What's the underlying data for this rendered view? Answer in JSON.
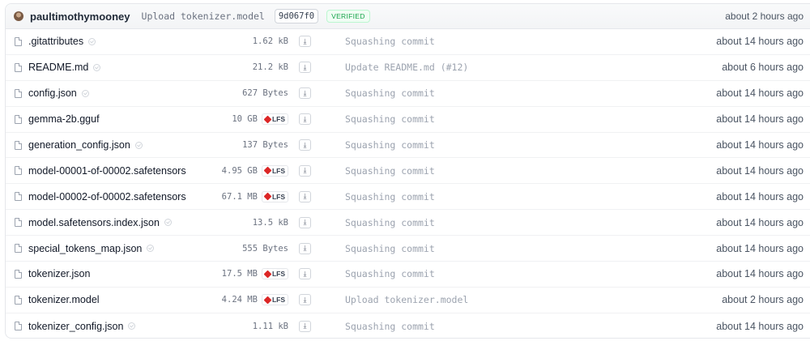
{
  "commit": {
    "author": "paultimothymooney",
    "message": "Upload tokenizer.model",
    "hash": "9d067f0",
    "verified_label": "VERIFIED",
    "time": "about 2 hours ago"
  },
  "lfs_label": "LFS",
  "files": [
    {
      "name": ".gitattributes",
      "size": "1.62 kB",
      "lfs": false,
      "commit": "Squashing commit",
      "time": "about 14 hours ago"
    },
    {
      "name": "README.md",
      "size": "21.2 kB",
      "lfs": false,
      "commit": "Update README.md (#12)",
      "time": "about 6 hours ago"
    },
    {
      "name": "config.json",
      "size": "627 Bytes",
      "lfs": false,
      "commit": "Squashing commit",
      "time": "about 14 hours ago"
    },
    {
      "name": "gemma-2b.gguf",
      "size": "10 GB",
      "lfs": true,
      "commit": "Squashing commit",
      "time": "about 14 hours ago"
    },
    {
      "name": "generation_config.json",
      "size": "137 Bytes",
      "lfs": false,
      "commit": "Squashing commit",
      "time": "about 14 hours ago"
    },
    {
      "name": "model-00001-of-00002.safetensors",
      "size": "4.95 GB",
      "lfs": true,
      "commit": "Squashing commit",
      "time": "about 14 hours ago"
    },
    {
      "name": "model-00002-of-00002.safetensors",
      "size": "67.1 MB",
      "lfs": true,
      "commit": "Squashing commit",
      "time": "about 14 hours ago"
    },
    {
      "name": "model.safetensors.index.json",
      "size": "13.5 kB",
      "lfs": false,
      "commit": "Squashing commit",
      "time": "about 14 hours ago"
    },
    {
      "name": "special_tokens_map.json",
      "size": "555 Bytes",
      "lfs": false,
      "commit": "Squashing commit",
      "time": "about 14 hours ago"
    },
    {
      "name": "tokenizer.json",
      "size": "17.5 MB",
      "lfs": true,
      "commit": "Squashing commit",
      "time": "about 14 hours ago"
    },
    {
      "name": "tokenizer.model",
      "size": "4.24 MB",
      "lfs": true,
      "commit": "Upload tokenizer.model",
      "time": "about 2 hours ago"
    },
    {
      "name": "tokenizer_config.json",
      "size": "1.11 kB",
      "lfs": false,
      "commit": "Squashing commit",
      "time": "about 14 hours ago"
    }
  ]
}
